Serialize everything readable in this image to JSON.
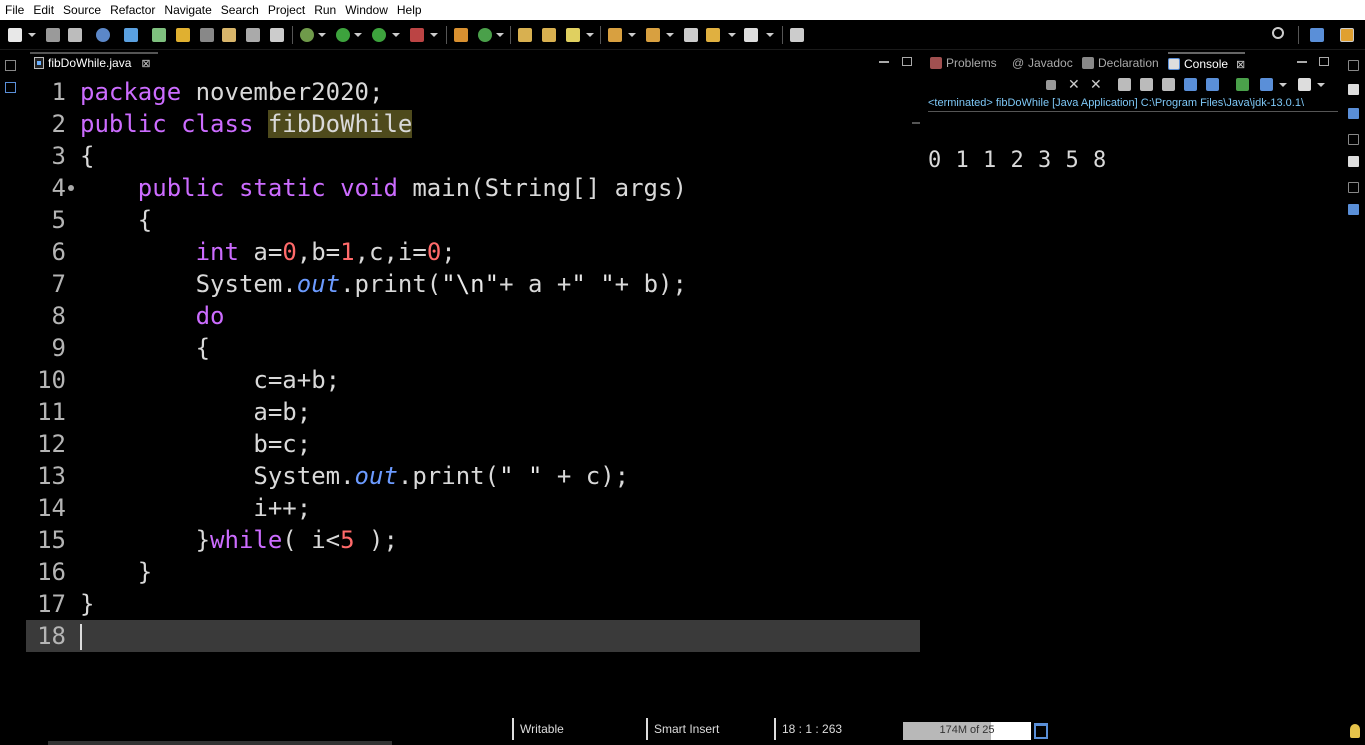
{
  "menu": [
    "File",
    "Edit",
    "Source",
    "Refactor",
    "Navigate",
    "Search",
    "Project",
    "Run",
    "Window",
    "Help"
  ],
  "editor": {
    "tab_label": "fibDoWhile.java",
    "tab_close": "⊠"
  },
  "code_lines": [
    {
      "n": "1"
    },
    {
      "n": "2"
    },
    {
      "n": "3"
    },
    {
      "n": "4"
    },
    {
      "n": "5"
    },
    {
      "n": "6"
    },
    {
      "n": "7"
    },
    {
      "n": "8"
    },
    {
      "n": "9"
    },
    {
      "n": "10"
    },
    {
      "n": "11"
    },
    {
      "n": "12"
    },
    {
      "n": "13"
    },
    {
      "n": "14"
    },
    {
      "n": "15"
    },
    {
      "n": "16"
    },
    {
      "n": "17"
    },
    {
      "n": "18"
    }
  ],
  "code": {
    "l1_kw": "package",
    "l1_rest": " november2020;",
    "l2_kw1": "public",
    "l2_kw2": "class",
    "l2_name": "fibDoWhile",
    "l3": "{",
    "l4_kw1": "public",
    "l4_kw2": "static",
    "l4_kw3": "void",
    "l4_rest": " main(String[] args)",
    "l5": "{",
    "l6_kw": "int",
    "l6_a": " a=",
    "l6_n0": "0",
    "l6_b": ",b=",
    "l6_n1": "1",
    "l6_c": ",c,i=",
    "l6_n2": "0",
    "l6_end": ";",
    "l7_a": "System.",
    "l7_out": "out",
    "l7_b": ".print(",
    "l7_s1": "\"\\n\"",
    "l7_c": "+ a +",
    "l7_s2": "\" \"",
    "l7_d": "+ b);",
    "l8_kw": "do",
    "l9": "{",
    "l10": "c=a+b;",
    "l11": "a=b;",
    "l12": "b=c;",
    "l13_a": "System.",
    "l13_out": "out",
    "l13_b": ".print(",
    "l13_s": "\" \"",
    "l13_c": " + c);",
    "l14": "i++;",
    "l15_a": "}",
    "l15_kw": "while",
    "l15_b": "( i<",
    "l15_n": "5",
    "l15_c": " );",
    "l16": "}",
    "l17": "}",
    "l18": ""
  },
  "views": {
    "problems": "Problems",
    "javadoc": "Javadoc",
    "declaration": "Declaration",
    "console": "Console",
    "console_close": "⊠"
  },
  "console": {
    "terminated": "<terminated> fibDoWhile [Java Application] C:\\Program Files\\Java\\jdk-13.0.1\\",
    "output": "0 1 1 2 3 5 8"
  },
  "status": {
    "writable": "Writable",
    "insert_mode": "Smart Insert",
    "position": "18 : 1 : 263",
    "heap": "174M of 25",
    "heap_fraction": 0.69
  },
  "colors": {
    "keyword": "#cc6cff",
    "number": "#ff6a6a",
    "field": "#6c9bff",
    "terminated": "#7ec8f7"
  }
}
